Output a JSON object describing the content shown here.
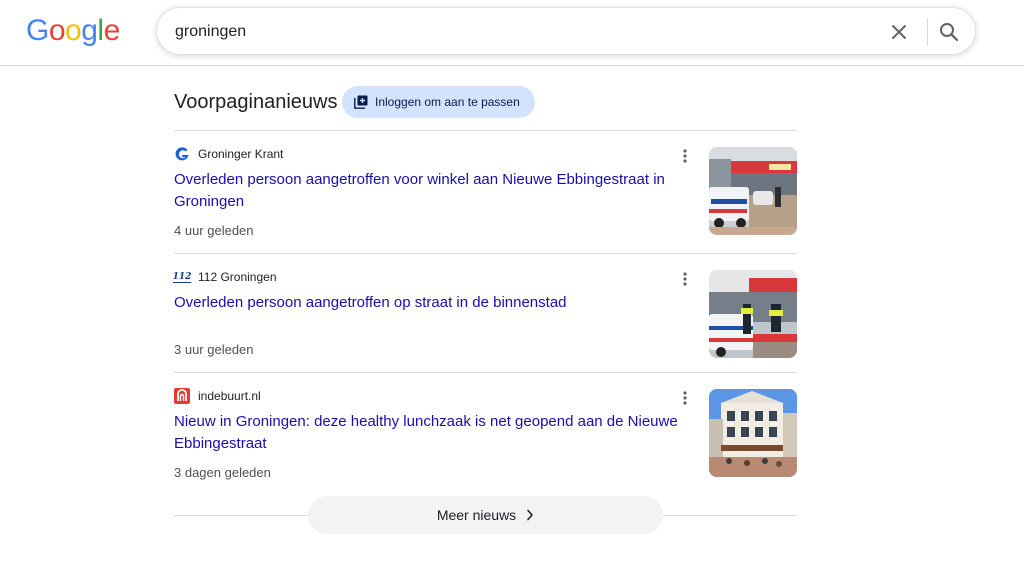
{
  "logo": {
    "letters": [
      "G",
      "o",
      "o",
      "g",
      "l",
      "e"
    ],
    "colors": [
      "#4285f4",
      "#ea4335",
      "#fbbc05",
      "#4285f4",
      "#34a853",
      "#ea4335"
    ]
  },
  "search": {
    "value": "groningen",
    "clear_icon": "close-icon",
    "search_icon": "search-icon"
  },
  "section": {
    "title": "Voorpaginanieuws",
    "chip_label": "Inloggen om aan te passen",
    "chip_icon": "library-add-icon"
  },
  "articles": [
    {
      "source": "Groninger Krant",
      "headline": "Overleden persoon aangetroffen voor winkel aan Nieuwe Ebbingestraat in Groningen",
      "age": "4 uur geleden",
      "favicon": "groninger-krant-icon",
      "accent": "#1a5fd1"
    },
    {
      "source": "112 Groningen",
      "headline": "Overleden persoon aangetroffen op straat in de binnenstad",
      "age": "3 uur geleden",
      "favicon": "112-groningen-icon",
      "favicon_text": "112",
      "accent": "#1a3a8f"
    },
    {
      "source": "indebuurt.nl",
      "headline": "Nieuw in Groningen: deze healthy lunchzaak is net geopend aan de Nieuwe Ebbingestraat",
      "age": "3 dagen geleden",
      "favicon": "indebuurt-icon",
      "accent": "#e53935"
    }
  ],
  "more_news": {
    "label": "Meer nieuws",
    "icon": "chevron-right-icon"
  },
  "colors": {
    "link": "#1a0dab",
    "chip_bg": "#d3e3fd",
    "divider": "#dadce0"
  }
}
